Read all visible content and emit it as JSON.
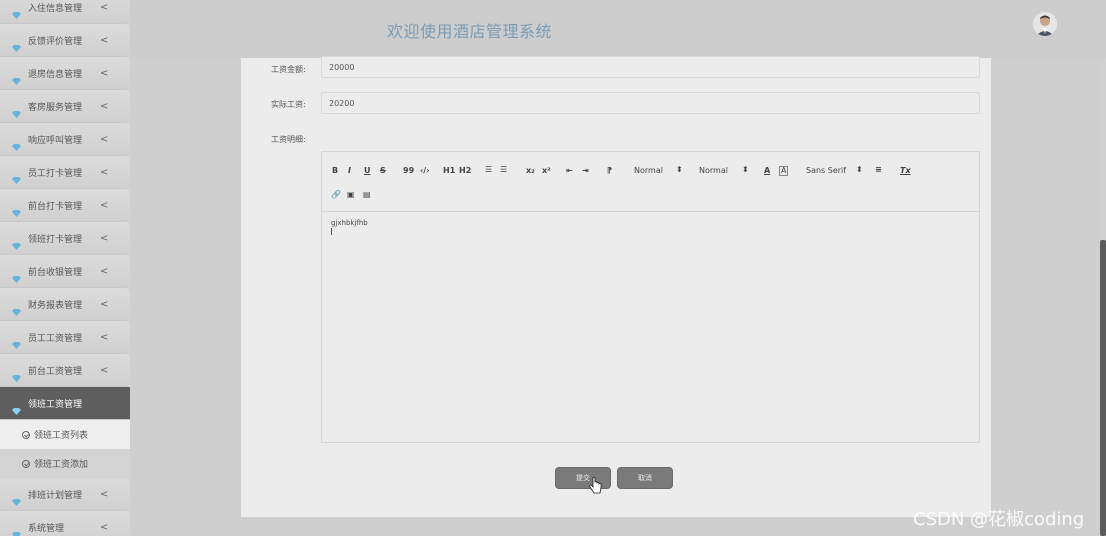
{
  "app": {
    "title": "欢迎使用酒店管理系统"
  },
  "sidebar": {
    "items": [
      {
        "label": "入住信息管理",
        "chevron": "<"
      },
      {
        "label": "反馈评价管理",
        "chevron": "<"
      },
      {
        "label": "退房信息管理",
        "chevron": "<"
      },
      {
        "label": "客房服务管理",
        "chevron": "<"
      },
      {
        "label": "响应呼叫管理",
        "chevron": "<"
      },
      {
        "label": "员工打卡管理",
        "chevron": "<"
      },
      {
        "label": "前台打卡管理",
        "chevron": "<"
      },
      {
        "label": "领班打卡管理",
        "chevron": "<"
      },
      {
        "label": "前台收银管理",
        "chevron": "<"
      },
      {
        "label": "财务报表管理",
        "chevron": "<"
      },
      {
        "label": "员工工资管理",
        "chevron": "<"
      },
      {
        "label": "前台工资管理",
        "chevron": "<"
      },
      {
        "label": "领班工资管理",
        "chevron": ""
      }
    ],
    "subitems": [
      {
        "label": "领班工资列表"
      },
      {
        "label": "领班工资添加"
      }
    ],
    "after_items": [
      {
        "label": "排班计划管理",
        "chevron": "<"
      },
      {
        "label": "系统管理",
        "chevron": "<"
      }
    ]
  },
  "form": {
    "salary_amount": {
      "label": "工资金额:",
      "value": "20000"
    },
    "actual_salary": {
      "label": "实际工资:",
      "value": "20200"
    },
    "salary_details": {
      "label": "工资明细:"
    }
  },
  "editor": {
    "content": "gjxhbkjfhb",
    "toolbar": {
      "bold": "B",
      "italic": "I",
      "underline": "U",
      "strike": "S",
      "quote": "99",
      "code": "‹/›",
      "h1": "H1",
      "h2": "H2",
      "ordered_list": "☰",
      "bullet_list": "☰",
      "sub": "x₂",
      "sup": "x²",
      "outdent": "⇤",
      "indent": "⇥",
      "direction": "⁋",
      "size_select": "Normal",
      "header_select": "Normal",
      "color": "A",
      "background": "A",
      "font_select": "Sans Serif",
      "align": "≡",
      "clean": "Tx",
      "link": "🔗",
      "image": "▣",
      "video": "▤"
    }
  },
  "buttons": {
    "submit": "提交",
    "cancel": "取消"
  },
  "watermark": "CSDN @花椒coding",
  "colors": {
    "header_title": "#7a9bb4",
    "sidebar_active": "#5e5e5e",
    "button": "#7a7a7a",
    "gem": "#6ab3d8"
  }
}
